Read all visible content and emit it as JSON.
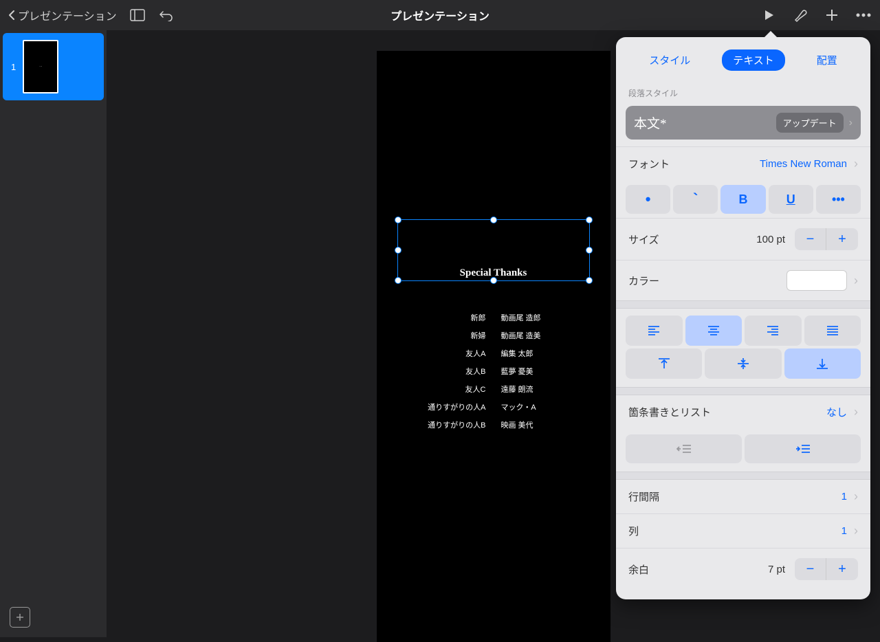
{
  "toolbar": {
    "back_label": "プレゼンテーション",
    "title": "プレゼンテーション"
  },
  "sidebar": {
    "slide_number": "1"
  },
  "slide": {
    "special_thanks": "Special Thanks",
    "credits": [
      {
        "role": "新郎",
        "name": "動画尾 造郎"
      },
      {
        "role": "新婦",
        "name": "動画尾 造美"
      },
      {
        "role": "友人A",
        "name": "編集 太郎"
      },
      {
        "role": "友人B",
        "name": "藍夢 憂美"
      },
      {
        "role": "友人C",
        "name": "遠藤 朗流"
      },
      {
        "role": "通りすがりの人A",
        "name": "マック・A"
      },
      {
        "role": "通りすがりの人B",
        "name": "映画 美代"
      }
    ]
  },
  "inspector": {
    "tabs": {
      "style": "スタイル",
      "text": "テキスト",
      "arrange": "配置"
    },
    "paragraph_style_label": "段落スタイル",
    "paragraph_style_name": "本文*",
    "update_label": "アップデート",
    "font_label": "フォント",
    "font_value": "Times New Roman",
    "bold_label": "B",
    "underline_label": "U",
    "more_label": "•••",
    "size_label": "サイズ",
    "size_value": "100 pt",
    "color_label": "カラー",
    "color_value": "#ffffff",
    "bullets_label": "箇条書きとリスト",
    "bullets_value": "なし",
    "line_spacing_label": "行間隔",
    "line_spacing_value": "1",
    "columns_label": "列",
    "columns_value": "1",
    "margin_label": "余白",
    "margin_value": "7 pt"
  }
}
